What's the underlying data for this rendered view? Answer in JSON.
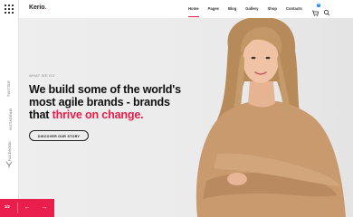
{
  "brand": {
    "name": "Kerio",
    "dot": "."
  },
  "nav": [
    "Home",
    "Pages",
    "Blog",
    "Gallery",
    "Shop",
    "Contacts"
  ],
  "cart": {
    "count": "0"
  },
  "social": [
    "Twitter",
    "Instagram",
    "Facebook"
  ],
  "hero": {
    "eyebrow": "What we do",
    "headline_line1": "We build some of the world's",
    "headline_line2": "most agile brands - brands",
    "headline_prefix": "that ",
    "headline_accent": "thrive on change.",
    "cta": "Discover our story"
  },
  "slider": {
    "counter": "1/2",
    "prev": "←",
    "next": "→"
  },
  "colors": {
    "accent": "#e91e4c",
    "badge": "#1e88e5"
  }
}
